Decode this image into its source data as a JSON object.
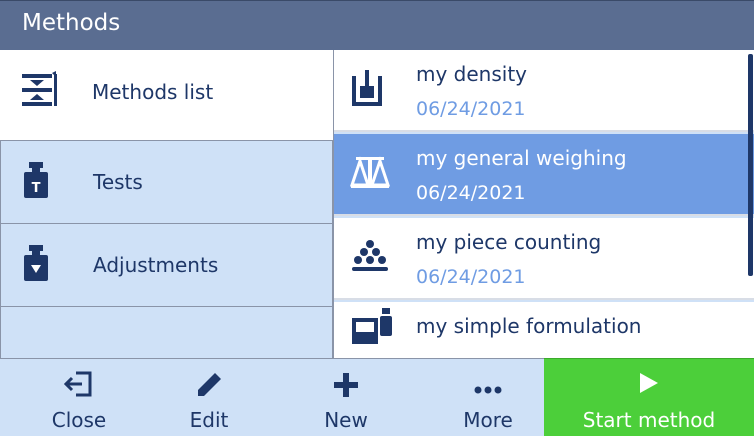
{
  "window": {
    "title": "Methods"
  },
  "nav": {
    "items": [
      {
        "label": "Methods list",
        "icon": "methods-list-icon"
      },
      {
        "label": "Tests",
        "icon": "test-weight-icon"
      },
      {
        "label": "Adjustments",
        "icon": "adjustment-weight-icon"
      }
    ]
  },
  "methods": [
    {
      "name": "my density",
      "date": "06/24/2021",
      "icon": "density-icon"
    },
    {
      "name": "my general weighing",
      "date": "06/24/2021",
      "icon": "balance-icon"
    },
    {
      "name": "my piece counting",
      "date": "06/24/2021",
      "icon": "piece-counting-icon"
    },
    {
      "name": "my simple formulation",
      "date": "",
      "icon": "formulation-icon"
    }
  ],
  "toolbar": {
    "close": "Close",
    "edit": "Edit",
    "new": "New",
    "more": "More",
    "start": "Start method"
  },
  "colors": {
    "title_bar": "#5a6d91",
    "nav_bg": "#cfe1f7",
    "selected_row": "#6f9ce3",
    "text_dark": "#1e3768",
    "start_green": "#4ccf3a"
  }
}
